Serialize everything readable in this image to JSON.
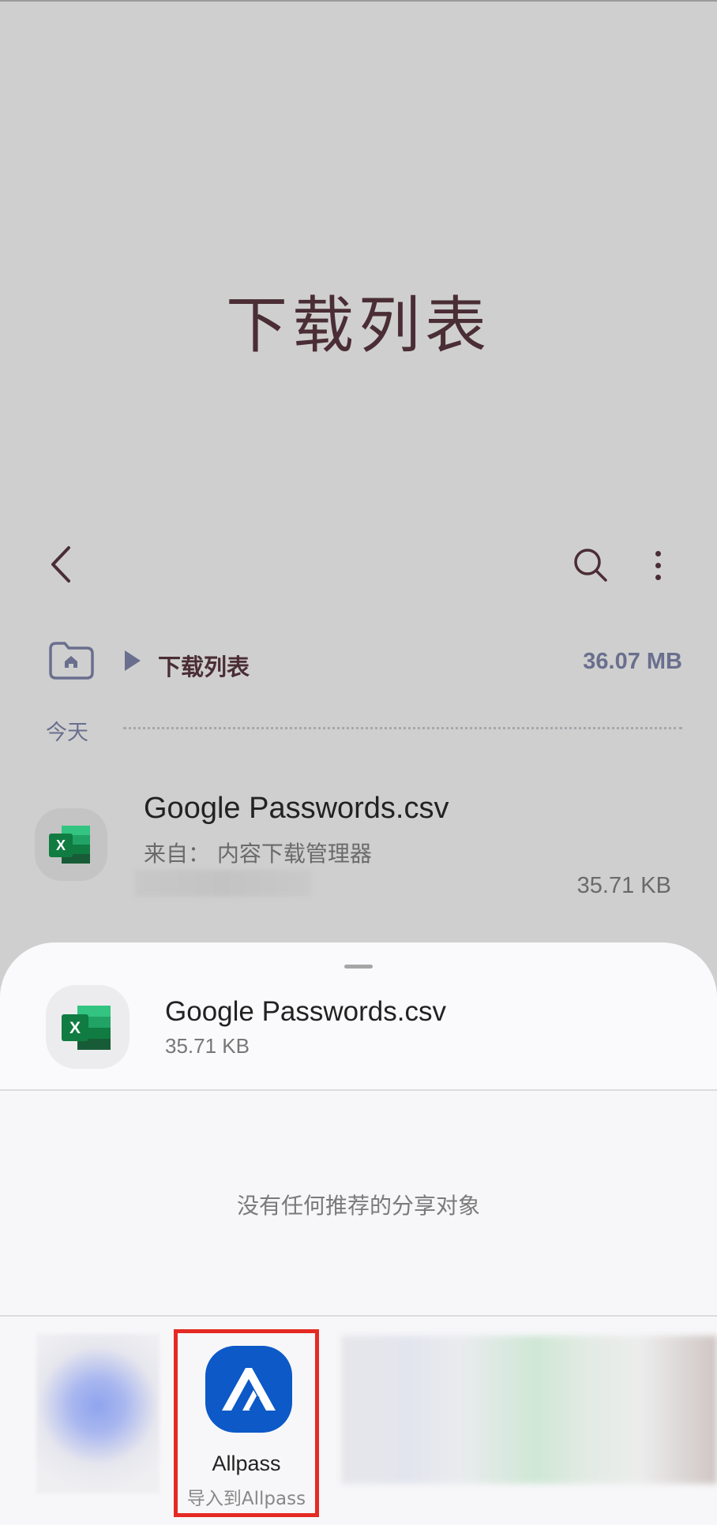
{
  "screen": {
    "title": "下载列表",
    "back_icon": "chevron-left-icon",
    "search_icon": "search-icon",
    "more_icon": "more-vertical-icon"
  },
  "path": {
    "home_icon": "folder-home-icon",
    "current": "下载列表",
    "total_size": "36.07 MB"
  },
  "section": {
    "label": "今天"
  },
  "file": {
    "name": "Google Passwords.csv",
    "source": "来自：  内容下载管理器",
    "size": "35.71 KB",
    "icon": "excel-icon"
  },
  "share_sheet": {
    "file_name": "Google Passwords.csv",
    "file_size": "35.71 KB",
    "no_recommend_text": "没有任何推荐的分享对象",
    "apps": [
      {
        "name": "Allpass",
        "subtitle": "导入到Allpass",
        "icon": "allpass-icon",
        "color": "#0c59c7",
        "highlight_color": "#e52a23"
      }
    ]
  }
}
